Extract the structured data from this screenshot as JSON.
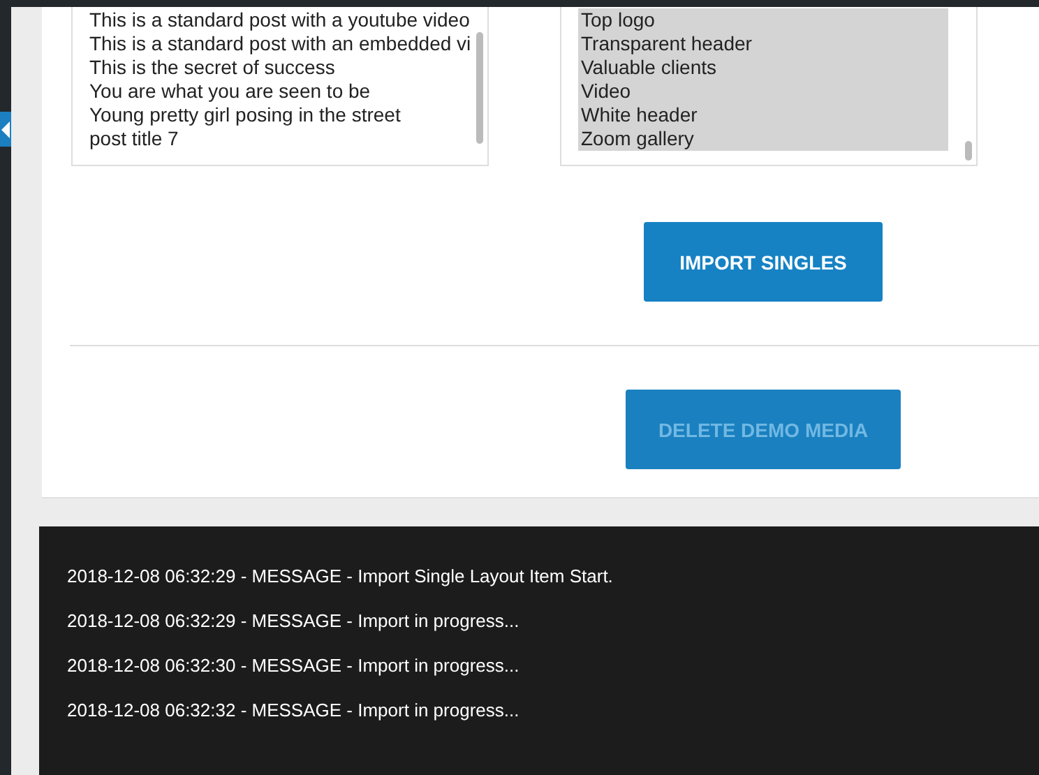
{
  "posts_list": {
    "items": [
      {
        "label": "This is a standard post with a youtube video",
        "selected": false
      },
      {
        "label": "This is a standard post with an embedded vi",
        "selected": false
      },
      {
        "label": "This is the secret of success",
        "selected": false
      },
      {
        "label": "You are what you are seen to be",
        "selected": false
      },
      {
        "label": "Young pretty girl posing in the street",
        "selected": false
      },
      {
        "label": "post title 7",
        "selected": false
      }
    ]
  },
  "layouts_list": {
    "items": [
      {
        "label": "Top logo",
        "selected": true
      },
      {
        "label": "Transparent header",
        "selected": true
      },
      {
        "label": "Valuable clients",
        "selected": true
      },
      {
        "label": "Video",
        "selected": true
      },
      {
        "label": "White header",
        "selected": true
      },
      {
        "label": "Zoom gallery",
        "selected": true
      }
    ]
  },
  "import_button": {
    "label": "IMPORT SINGLES",
    "disabled": false
  },
  "delete_button": {
    "label": "DELETE DEMO MEDIA",
    "disabled": true
  },
  "log": [
    "2018-12-08 06:32:29 - MESSAGE - Import Single Layout Item Start.",
    "2018-12-08 06:32:29 - MESSAGE - Import in progress...",
    "2018-12-08 06:32:30 - MESSAGE - Import in progress...",
    "2018-12-08 06:32:32 - MESSAGE - Import in progress..."
  ]
}
